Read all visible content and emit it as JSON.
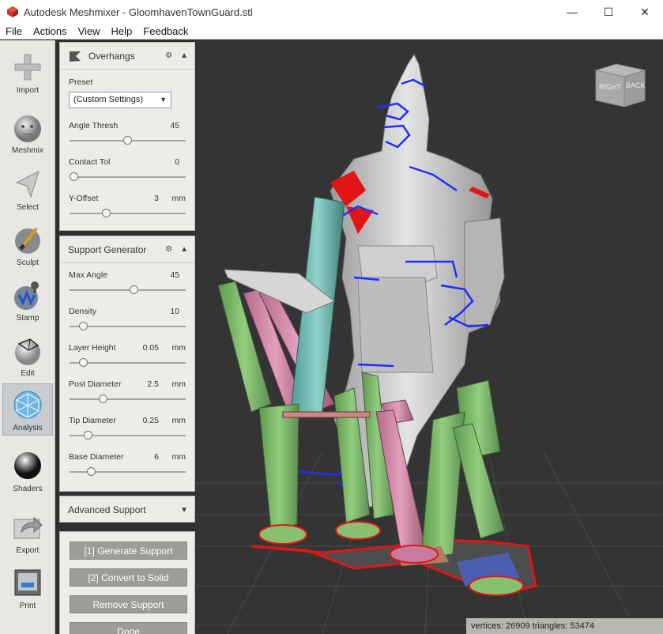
{
  "window": {
    "title": "Autodesk Meshmixer - GloomhavenTownGuard.stl",
    "minimize": "—",
    "maximize": "☐",
    "close": "✕"
  },
  "menu": [
    "File",
    "Actions",
    "View",
    "Help",
    "Feedback"
  ],
  "tools": [
    {
      "label": "Import",
      "icon": "plus-icon"
    },
    {
      "label": "Meshmix",
      "icon": "bunny-head-icon"
    },
    {
      "label": "Select",
      "icon": "cursor-arrow-icon"
    },
    {
      "label": "Sculpt",
      "icon": "brush-icon"
    },
    {
      "label": "Stamp",
      "icon": "stamp-icon"
    },
    {
      "label": "Edit",
      "icon": "mesh-edit-icon"
    },
    {
      "label": "Analysis",
      "icon": "analysis-sphere-icon",
      "active": true
    },
    {
      "label": "Shaders",
      "icon": "shader-sphere-icon"
    },
    {
      "label": "Export",
      "icon": "export-icon"
    },
    {
      "label": "Print",
      "icon": "printer-icon"
    }
  ],
  "overhangs": {
    "title": "Overhangs",
    "preset_label": "Preset",
    "preset_value": "(Custom Settings)",
    "angle_label": "Angle Thresh",
    "angle_value": "45",
    "angle_fraction": 0.5,
    "contact_label": "Contact Tol",
    "contact_value": "0",
    "contact_fraction": 0.0,
    "yoffset_label": "Y-Offset",
    "yoffset_value": "3",
    "yoffset_unit": "mm",
    "yoffset_fraction": 0.3
  },
  "support": {
    "title": "Support Generator",
    "max_angle_label": "Max Angle",
    "max_angle_value": "45",
    "max_angle_fraction": 0.56,
    "density_label": "Density",
    "density_value": "10",
    "density_fraction": 0.09,
    "layer_label": "Layer Height",
    "layer_value": "0.05",
    "layer_unit": "mm",
    "layer_fraction": 0.09,
    "post_label": "Post Diameter",
    "post_value": "2.5",
    "post_unit": "mm",
    "post_fraction": 0.27,
    "tip_label": "Tip Diameter",
    "tip_value": "0.25",
    "tip_unit": "mm",
    "tip_fraction": 0.13,
    "base_label": "Base Diameter",
    "base_value": "6",
    "base_unit": "mm",
    "base_fraction": 0.16
  },
  "advanced": {
    "title": "Advanced Support"
  },
  "actions": {
    "generate": "[1] Generate Support",
    "convert": "[2] Convert to Solid",
    "remove": "Remove Support",
    "done": "Done"
  },
  "viewcube": {
    "right": "RIGHT",
    "back": "BACK"
  },
  "status": "vertices: 26909 triangles: 53474",
  "colors": {
    "accent_active": "#c8cbd0",
    "overhang_red": "#e21515",
    "overhang_blue": "#1f2dff",
    "support_green": "#7fbf6a"
  }
}
